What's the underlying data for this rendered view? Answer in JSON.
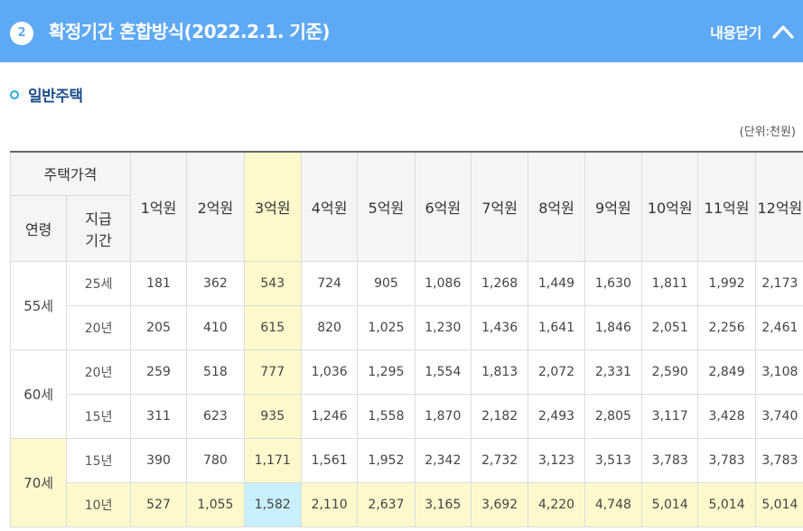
{
  "header": {
    "number": "2",
    "title": "확정기간 혼합방식(2022.2.1. 기준)",
    "close_label": "내용닫기",
    "background": "#5ea9f4"
  },
  "section": {
    "title": "일반주택"
  },
  "unit_label": "(단위:천원)",
  "table": {
    "corner_top": "주택가격",
    "corner_age": "연령",
    "corner_period": "지급\n기간",
    "price_columns": [
      "1억원",
      "2억원",
      "3억원",
      "4억원",
      "5억원",
      "6억원",
      "7억원",
      "8억원",
      "9억원",
      "10억원",
      "11억원",
      "12억원"
    ],
    "highlight_column_index": 2,
    "groups": [
      {
        "age": "55세",
        "rows": [
          {
            "period": "25세",
            "values": [
              "181",
              "362",
              "543",
              "724",
              "905",
              "1,086",
              "1,268",
              "1,449",
              "1,630",
              "1,811",
              "1,992",
              "2,173"
            ]
          },
          {
            "period": "20년",
            "values": [
              "205",
              "410",
              "615",
              "820",
              "1,025",
              "1,230",
              "1,436",
              "1,641",
              "1,846",
              "2,051",
              "2,256",
              "2,461"
            ]
          }
        ]
      },
      {
        "age": "60세",
        "rows": [
          {
            "period": "20년",
            "values": [
              "259",
              "518",
              "777",
              "1,036",
              "1,295",
              "1,554",
              "1,813",
              "2,072",
              "2,331",
              "2,590",
              "2,849",
              "3,108"
            ]
          },
          {
            "period": "15년",
            "values": [
              "311",
              "623",
              "935",
              "1,246",
              "1,558",
              "1,870",
              "2,182",
              "2,493",
              "2,805",
              "3,117",
              "3,428",
              "3,740"
            ]
          }
        ]
      },
      {
        "age": "70세",
        "highlight": true,
        "rows": [
          {
            "period": "15년",
            "values": [
              "390",
              "780",
              "1,171",
              "1,561",
              "1,952",
              "2,342",
              "2,732",
              "3,123",
              "3,513",
              "3,783",
              "3,783",
              "3,783"
            ]
          },
          {
            "period": "10년",
            "highlight": true,
            "values": [
              "527",
              "1,055",
              "1,582",
              "2,110",
              "2,637",
              "3,165",
              "3,692",
              "4,220",
              "4,748",
              "5,014",
              "5,014",
              "5,014"
            ]
          }
        ]
      }
    ]
  }
}
